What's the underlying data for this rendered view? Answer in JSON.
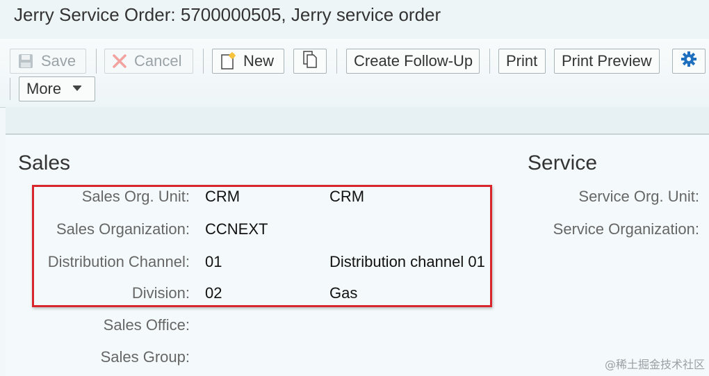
{
  "header": {
    "title": "Jerry Service Order: 5700000505, Jerry service order"
  },
  "toolbar": {
    "save_label": "Save",
    "cancel_label": "Cancel",
    "new_label": "New",
    "follow_up_label": "Create Follow-Up",
    "print_label": "Print",
    "print_preview_label": "Print Preview",
    "more_label": "More",
    "icons": {
      "save": "save-disk-icon",
      "cancel": "cancel-x-icon",
      "new": "new-document-icon",
      "copy": "copy-icon",
      "settings": "gear-icon",
      "more": "dropdown-triangle-icon"
    }
  },
  "sales": {
    "title": "Sales",
    "fields": [
      {
        "label": "Sales Org. Unit:",
        "value": "CRM",
        "description": "CRM"
      },
      {
        "label": "Sales Organization:",
        "value": "CCNEXT",
        "description": ""
      },
      {
        "label": "Distribution Channel:",
        "value": "01",
        "description": "Distribution channel 01"
      },
      {
        "label": "Division:",
        "value": "02",
        "description": "Gas"
      },
      {
        "label": "Sales Office:",
        "value": "",
        "description": ""
      },
      {
        "label": "Sales Group:",
        "value": "",
        "description": ""
      }
    ]
  },
  "service": {
    "title": "Service",
    "fields": [
      {
        "label": "Service Org. Unit:"
      },
      {
        "label": "Service Organization:"
      }
    ]
  },
  "colors": {
    "highlight": "#d9262c",
    "accent": "#1f6fbf"
  },
  "watermark": "@稀土掘金技术社区"
}
